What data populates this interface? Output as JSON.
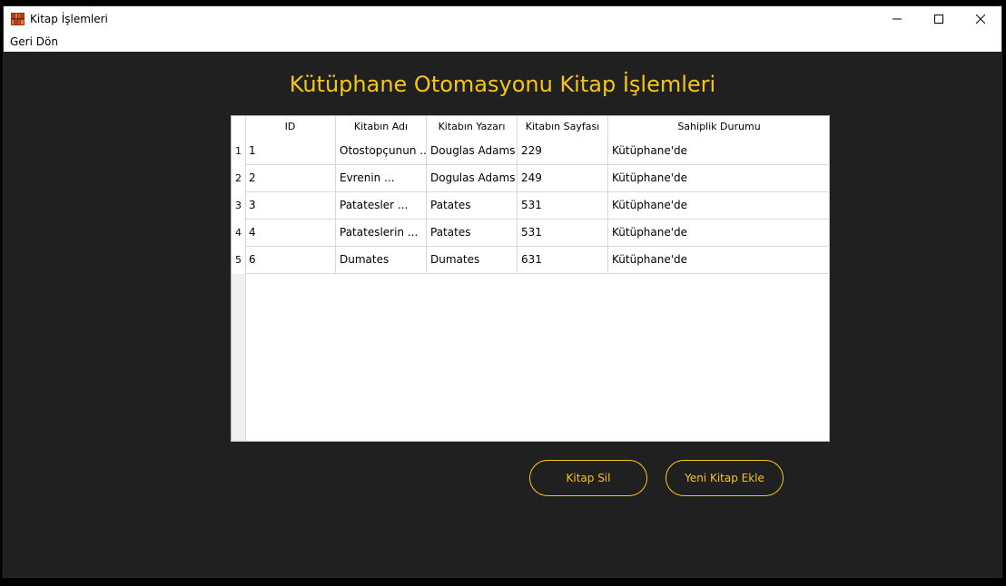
{
  "window": {
    "title": "Kitap İşlemleri"
  },
  "menu": {
    "back_label": "Geri Dön"
  },
  "heading": "Kütüphane Otomasyonu Kitap İşlemleri",
  "table": {
    "columns": [
      "ID",
      "Kitabın Adı",
      "Kitabın Yazarı",
      "Kitabın Sayfası",
      "Sahiplik Durumu"
    ],
    "rows": [
      {
        "num": "1",
        "cells": [
          "1",
          "Otostopçunun ...",
          "Douglas Adams",
          "229",
          "Kütüphane'de"
        ]
      },
      {
        "num": "2",
        "cells": [
          "2",
          "Evrenin ...",
          "Dogulas Adams",
          "249",
          "Kütüphane'de"
        ]
      },
      {
        "num": "3",
        "cells": [
          "3",
          "Patatesler ...",
          "Patates",
          "531",
          "Kütüphane'de"
        ]
      },
      {
        "num": "4",
        "cells": [
          "4",
          "Patateslerin ...",
          "Patates",
          "531",
          "Kütüphane'de"
        ]
      },
      {
        "num": "5",
        "cells": [
          "6",
          "Dumates",
          "Dumates",
          "631",
          "Kütüphane'de"
        ]
      }
    ]
  },
  "buttons": {
    "delete_label": "Kitap Sil",
    "add_label": "Yeni Kitap Ekle"
  },
  "colors": {
    "accent": "#f5c518",
    "background": "#202020"
  }
}
